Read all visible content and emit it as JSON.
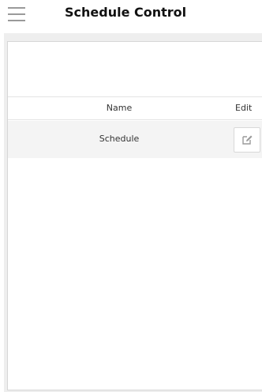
{
  "header": {
    "title": "Schedule Control",
    "menu_icon": "hamburger-menu-icon"
  },
  "table": {
    "columns": {
      "name": "Name",
      "edit": "Edit"
    },
    "rows": [
      {
        "name": "Schedule",
        "edit_icon": "edit-icon"
      }
    ]
  },
  "colors": {
    "title_text": "#111111",
    "row_highlight": "#f4f4f4",
    "icon_gray": "#9a9a9a"
  }
}
